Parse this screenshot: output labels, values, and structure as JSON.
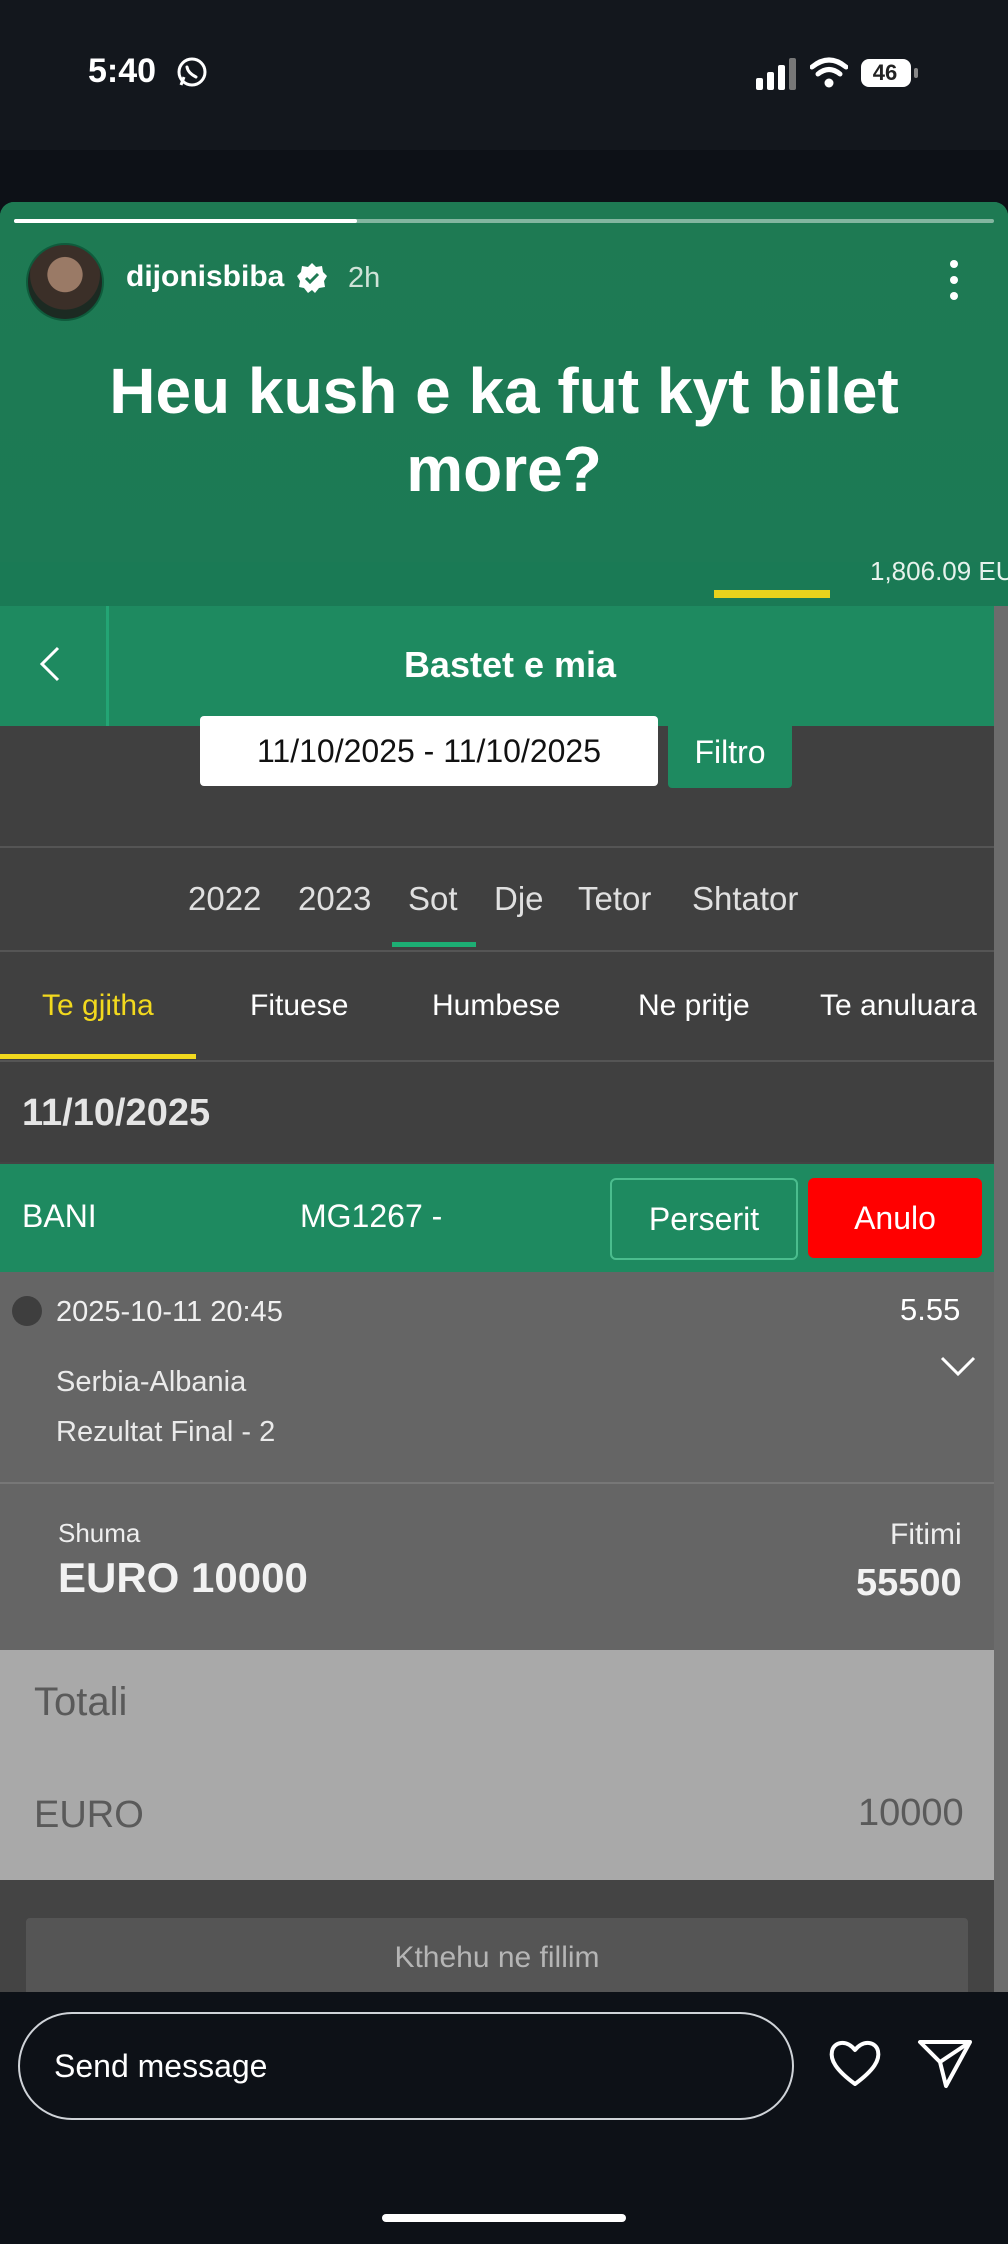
{
  "status_bar": {
    "time": "5:40",
    "battery": "46"
  },
  "story": {
    "progress": 0.35,
    "username": "dijonisbiba",
    "posted_ago": "2h",
    "caption": "Heu kush e ka fut kyt bilet more?"
  },
  "app": {
    "balance": "1,806.09 EU",
    "header_title": "Bastet e mia",
    "date_range": "11/10/2025 - 11/10/2025",
    "filter_label": "Filtro",
    "periods": [
      "2022",
      "2023",
      "Sot",
      "Dje",
      "Tetor",
      "Shtator"
    ],
    "active_period": "Sot",
    "tabs": [
      "Te gjitha",
      "Fituese",
      "Humbese",
      "Ne pritje",
      "Te anuluara"
    ],
    "active_tab": "Te gjitha",
    "day_label": "11/10/2025",
    "bet": {
      "type": "BANI",
      "code": "MG1267 -",
      "repeat_label": "Perserit",
      "cancel_label": "Anulo",
      "event_time": "2025-10-11 20:45",
      "odds": "5.55",
      "match": "Serbia-Albania",
      "market": "Rezultat Final - 2",
      "stake_label": "Shuma",
      "stake_value": "EURO 10000",
      "win_label": "Fitimi",
      "win_value": "55500"
    },
    "total": {
      "label": "Totali",
      "currency": "EURO",
      "amount": "10000"
    },
    "back_home_label": "Kthehu ne fillim"
  },
  "reply": {
    "placeholder": "Send message"
  },
  "colors": {
    "accent_green": "#1e8a60",
    "cancel_red": "#ff0000",
    "highlight_yellow": "#f2d91e"
  }
}
